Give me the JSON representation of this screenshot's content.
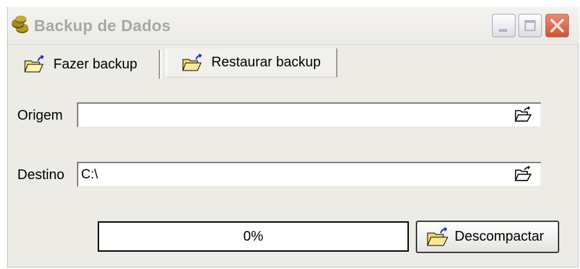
{
  "window": {
    "title": "Backup de Dados",
    "icon": "coins-icon"
  },
  "tabs": [
    {
      "label": "Fazer backup",
      "icon": "open-folder-arrow-icon",
      "active": false
    },
    {
      "label": "Restaurar backup",
      "icon": "open-folder-arrow-icon",
      "active": true
    }
  ],
  "form": {
    "origem": {
      "label": "Origem",
      "value": "",
      "browse_icon": "open-folder-icon"
    },
    "destino": {
      "label": "Destino",
      "value": "C:\\",
      "browse_icon": "open-folder-icon"
    }
  },
  "progress": {
    "text": "0%",
    "value": 0
  },
  "actions": {
    "decompress_label": "Descompactar",
    "decompress_icon": "open-folder-icon"
  },
  "colors": {
    "window_bg": "#ecebe6",
    "close_button": "#d0543a",
    "title_text_inactive": "#a8a7a2"
  }
}
